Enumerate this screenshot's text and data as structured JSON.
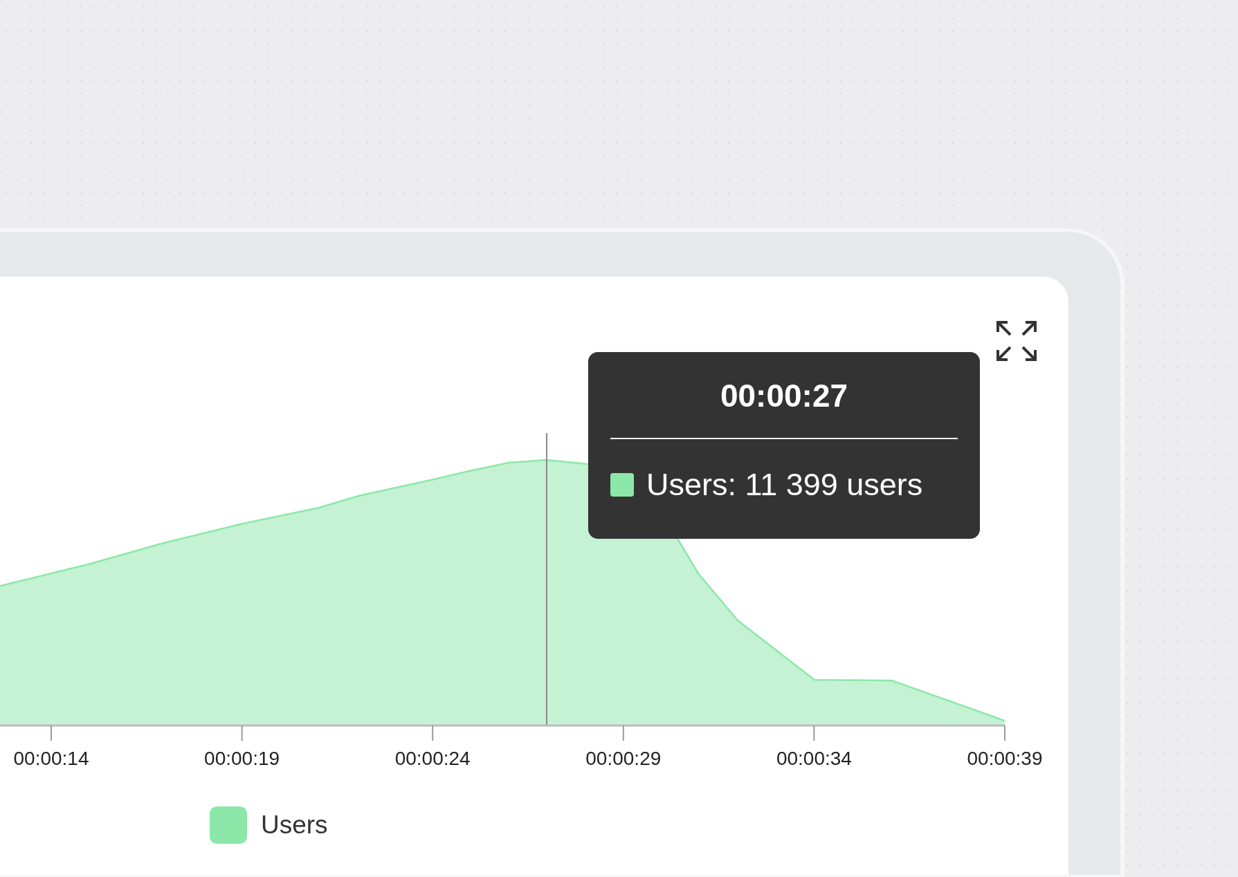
{
  "chart": {
    "x_labels": [
      "00:00:14",
      "00:00:19",
      "00:00:24",
      "00:00:29",
      "00:00:34",
      "00:00:39"
    ],
    "tooltip": {
      "title": "00:00:27",
      "rows": [
        {
          "text": "Users: 11 399 users",
          "color": "#8ce8a8"
        }
      ]
    },
    "legend": [
      {
        "label": "Users",
        "color": "#8ce8a8"
      }
    ]
  }
}
